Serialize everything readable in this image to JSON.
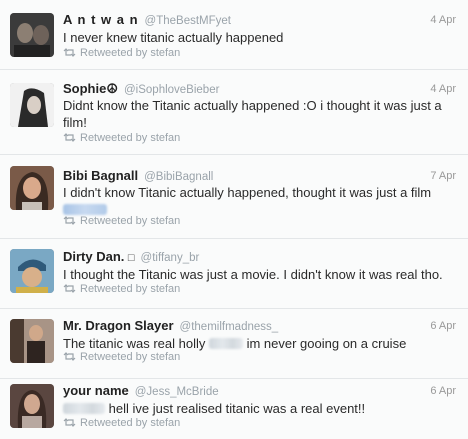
{
  "tweets": [
    {
      "name": "A n t w a n",
      "handle": "@TheBestMFyet",
      "date": "4 Apr",
      "text_parts": [
        "I never knew titanic actually happened"
      ],
      "retweet": "Retweeted by stefan",
      "avatar_color": "#3b3b3b",
      "avatar_accent": "#9c8e80"
    },
    {
      "name": "Sophie☮",
      "handle": "@iSophloveBieber",
      "date": "4 Apr",
      "text_parts": [
        "Didnt know the Titanic actually happened :O i thought it was just a",
        "film!"
      ],
      "retweet": "Retweeted by stefan",
      "avatar_color": "#e9e9e9",
      "avatar_accent": "#2a2a2a"
    },
    {
      "name": "Bibi Bagnall",
      "handle": "@BibiBagnall",
      "date": "7 Apr",
      "text_parts": [
        "I didn't know Titanic actually happened, thought it was just a film"
      ],
      "retweet": "Retweeted by stefan",
      "avatar_color": "#6b4b3c",
      "avatar_accent": "#d6a88c"
    },
    {
      "name": "Dirty Dan.",
      "handle": "@tiffany_br",
      "date": "",
      "text_parts": [
        "I thought the Titanic was just a movie. I didn't know it was real tho."
      ],
      "retweet": "Retweeted by stefan",
      "avatar_color": "#3a6c8a",
      "avatar_accent": "#d8b88f"
    },
    {
      "name": "Mr. Dragon Slayer",
      "handle": "@themilfmadness_",
      "date": "6 Apr",
      "text_parts": [
        "The titanic was real holly",
        "im never gooing on a cruise"
      ],
      "retweet": "Retweeted by stefan",
      "avatar_color": "#5a4535",
      "avatar_accent": "#c49a7a"
    },
    {
      "name": "your name",
      "handle": "@Jess_McBride",
      "date": "6 Apr",
      "text_parts": [
        "hell ive just realised titanic was a real event!!"
      ],
      "retweet": "Retweeted by stefan",
      "avatar_color": "#4a3a36",
      "avatar_accent": "#c9a38e"
    }
  ],
  "icons": {
    "retweet": "retweet-icon",
    "broken_glyph": "□"
  }
}
